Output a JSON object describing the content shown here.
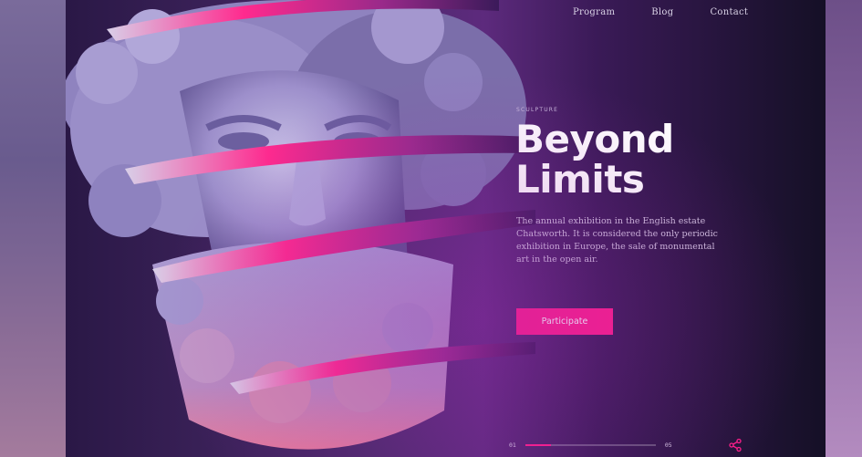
{
  "nav": {
    "items": [
      "Program",
      "Blog",
      "Contact"
    ]
  },
  "hero": {
    "eyebrow": "SCULPTURE",
    "title_line1": "Beyond",
    "title_line2": "Limits",
    "description": "The annual exhibition in the English estate Chatsworth. It is considered the only periodic exhibition in Europe, the sale of monumental art in the open air.",
    "cta_label": "Participate"
  },
  "pager": {
    "current": "01",
    "total": "05",
    "progress": 0.2
  },
  "icons": {
    "share": "share-icon"
  },
  "colors": {
    "accent": "#ff1e8a",
    "background": "#3a1a57"
  }
}
